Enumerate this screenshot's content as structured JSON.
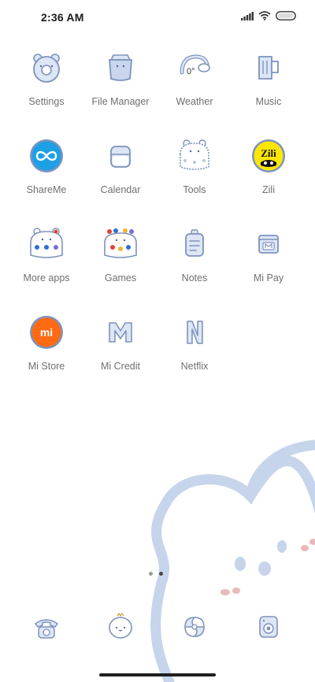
{
  "status_bar": {
    "time": "2:36 AM",
    "icons": [
      "signal-icon",
      "wifi-icon",
      "battery-icon"
    ]
  },
  "apps": [
    {
      "label": "Settings",
      "icon": "settings-bear-icon"
    },
    {
      "label": "File Manager",
      "icon": "file-manager-icon"
    },
    {
      "label": "Weather",
      "icon": "weather-icon"
    },
    {
      "label": "Music",
      "icon": "music-icon"
    },
    {
      "label": "ShareMe",
      "icon": "shareme-icon"
    },
    {
      "label": "Calendar",
      "icon": "calendar-icon"
    },
    {
      "label": "Tools",
      "icon": "tools-folder-icon"
    },
    {
      "label": "Zili",
      "icon": "zili-icon",
      "icon_text": "Zili"
    },
    {
      "label": "More apps",
      "icon": "more-apps-folder-icon"
    },
    {
      "label": "Games",
      "icon": "games-folder-icon"
    },
    {
      "label": "Notes",
      "icon": "notes-icon"
    },
    {
      "label": "Mi Pay",
      "icon": "mi-pay-icon"
    },
    {
      "label": "Mi Store",
      "icon": "mi-store-icon",
      "icon_text": "mi"
    },
    {
      "label": "Mi Credit",
      "icon": "mi-credit-icon"
    },
    {
      "label": "Netflix",
      "icon": "netflix-icon"
    }
  ],
  "dock": [
    {
      "icon": "phone-icon"
    },
    {
      "icon": "messages-icon"
    },
    {
      "icon": "browser-icon"
    },
    {
      "icon": "camera-icon"
    }
  ],
  "pager": {
    "pages": 2,
    "current": 2
  },
  "colors": {
    "icon_stroke": "#7d93bd",
    "icon_fill": "#dde6f5",
    "label": "#6f6f6f",
    "accent_blue": "#1ea0e6",
    "mi_orange": "#ff6a13",
    "zili_yellow": "#ffe600",
    "wallpaper_bear": "#c6d4ec"
  }
}
